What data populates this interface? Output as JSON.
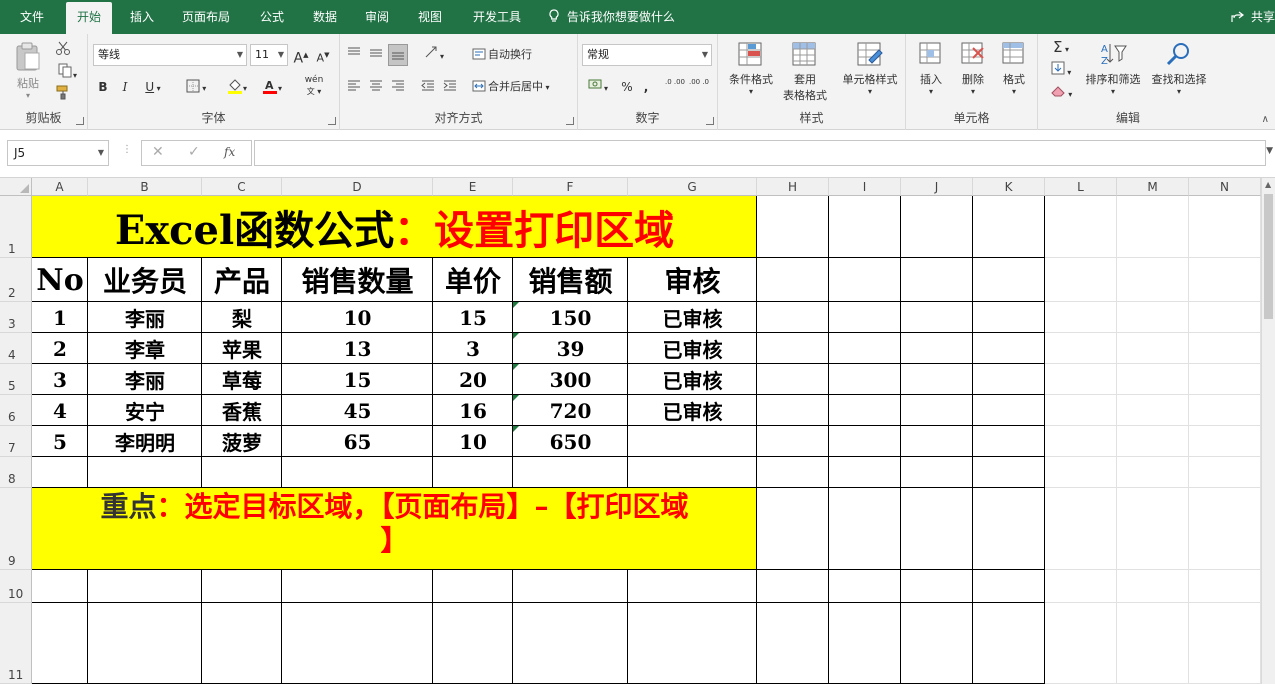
{
  "menu": {
    "tabs": [
      "文件",
      "开始",
      "插入",
      "页面布局",
      "公式",
      "数据",
      "审阅",
      "视图",
      "开发工具"
    ],
    "active": "开始",
    "tell_me": "告诉我你想要做什么",
    "share": "共享"
  },
  "ribbon": {
    "clipboard": {
      "paste": "粘贴",
      "label": "剪贴板"
    },
    "font": {
      "name": "等线",
      "size": "11",
      "bold": "B",
      "italic": "I",
      "underline": "U",
      "grow": "A",
      "shrink": "A",
      "wen": "wén",
      "label": "字体"
    },
    "alignment": {
      "wrap": "自动换行",
      "merge": "合并后居中",
      "label": "对齐方式"
    },
    "number": {
      "format": "常规",
      "percent": "%",
      "comma": ",",
      "inc": ".0 .00",
      "dec": ".00 .0",
      "label": "数字"
    },
    "styles": {
      "conditional": "条件格式",
      "table_line1": "套用",
      "table_line2": "表格格式",
      "cell": "单元格样式",
      "label": "样式"
    },
    "cells": {
      "insert": "插入",
      "delete": "删除",
      "format": "格式",
      "label": "单元格"
    },
    "editing": {
      "sort": "排序和筛选",
      "find": "查找和选择",
      "label": "编辑"
    }
  },
  "formula_bar": {
    "name_box": "J5",
    "fx": "fx",
    "value": ""
  },
  "columns": [
    "A",
    "B",
    "C",
    "D",
    "E",
    "F",
    "G",
    "H",
    "I",
    "J",
    "K",
    "L",
    "M",
    "N"
  ],
  "rows": [
    "1",
    "2",
    "3",
    "4",
    "5",
    "6",
    "7",
    "8",
    "9",
    "10",
    "11"
  ],
  "sheet": {
    "title_black": "Excel函数公式",
    "title_red": "：设置打印区域",
    "headers": [
      "No",
      "业务员",
      "产品",
      "销售数量",
      "单价",
      "销售额",
      "审核"
    ],
    "data": [
      [
        "1",
        "李丽",
        "梨",
        "10",
        "15",
        "150",
        "已审核"
      ],
      [
        "2",
        "李章",
        "苹果",
        "13",
        "3",
        "39",
        "已审核"
      ],
      [
        "3",
        "李丽",
        "草莓",
        "15",
        "20",
        "300",
        "已审核"
      ],
      [
        "4",
        "安宁",
        "香蕉",
        "45",
        "16",
        "720",
        "已审核"
      ],
      [
        "5",
        "李明明",
        "菠萝",
        "65",
        "10",
        "650",
        ""
      ]
    ],
    "note_black": "重点",
    "note_red": "：选定目标区域，【页面布局】–【打印区域",
    "note_red_line2": "】",
    "colors": {
      "yellow": "#ffff00",
      "red": "#ff0000",
      "ribbon_green": "#217346"
    }
  }
}
